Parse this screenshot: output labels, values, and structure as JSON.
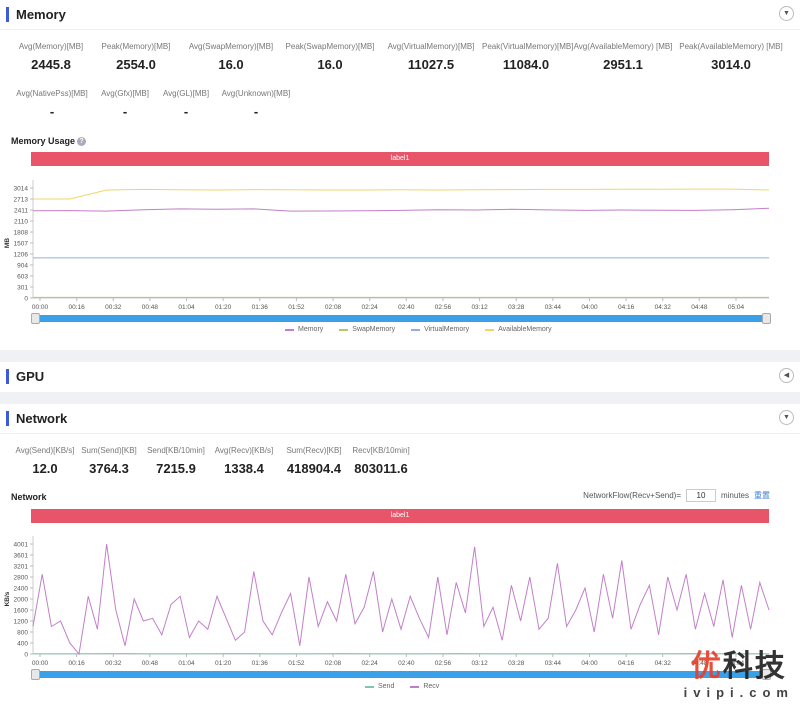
{
  "memory": {
    "title": "Memory",
    "stats_row1": [
      {
        "label": "Avg(Memory)[MB]",
        "value": "2445.8"
      },
      {
        "label": "Peak(Memory)[MB]",
        "value": "2554.0"
      },
      {
        "label": "Avg(SwapMemory)[MB]",
        "value": "16.0"
      },
      {
        "label": "Peak(SwapMemory)[MB]",
        "value": "16.0"
      },
      {
        "label": "Avg(VirtualMemory)[MB]",
        "value": "11027.5"
      },
      {
        "label": "Peak(VirtualMemory)[MB]",
        "value": "11084.0"
      },
      {
        "label": "Avg(AvailableMemory) [MB]",
        "value": "2951.1"
      },
      {
        "label": "Peak(AvailableMemory) [MB]",
        "value": "3014.0"
      }
    ],
    "stats_row2": [
      {
        "label": "Avg(NativePss)[MB]",
        "value": "-"
      },
      {
        "label": "Avg(Gfx)[MB]",
        "value": "-"
      },
      {
        "label": "Avg(GL)[MB]",
        "value": "-"
      },
      {
        "label": "Avg(Unknown)[MB]",
        "value": "-"
      }
    ],
    "chart_title": "Memory Usage",
    "label_bar": "label1"
  },
  "gpu": {
    "title": "GPU"
  },
  "network": {
    "title": "Network",
    "stats": [
      {
        "label": "Avg(Send)[KB/s]",
        "value": "12.0"
      },
      {
        "label": "Sum(Send)[KB]",
        "value": "3764.3"
      },
      {
        "label": "Send[KB/10min]",
        "value": "7215.9"
      },
      {
        "label": "Avg(Recv)[KB/s]",
        "value": "1338.4"
      },
      {
        "label": "Sum(Recv)[KB]",
        "value": "418904.4"
      },
      {
        "label": "Recv[KB/10min]",
        "value": "803011.6"
      }
    ],
    "chart_title": "Network",
    "flow_label": "NetworkFlow(Recv+Send)=",
    "flow_value": "10",
    "flow_unit": "minutes",
    "reset_label": "重置",
    "label_bar": "label1"
  },
  "watermark": {
    "top_red": "优",
    "top_dark": "科技",
    "bottom": "ivipi.com"
  },
  "chart_data": [
    {
      "type": "line",
      "title": "Memory Usage",
      "xlabel": "",
      "ylabel": "MB",
      "ylim": [
        0,
        3014
      ],
      "yticks": [
        0,
        301,
        603,
        904,
        1206,
        1507,
        1808,
        2110,
        2411,
        2713,
        3014
      ],
      "x": [
        "00:00",
        "00:16",
        "00:32",
        "00:48",
        "01:04",
        "01:20",
        "01:36",
        "01:52",
        "02:08",
        "02:24",
        "02:40",
        "02:56",
        "03:12",
        "03:28",
        "03:44",
        "04:00",
        "04:16",
        "04:32",
        "04:48",
        "05:04"
      ],
      "legend_position": "bottom",
      "series": [
        {
          "name": "Memory",
          "color": "#c27fc9",
          "values": [
            2390,
            2395,
            2380,
            2420,
            2440,
            2430,
            2440,
            2380,
            2385,
            2390,
            2400,
            2420,
            2410,
            2430,
            2415,
            2400,
            2410,
            2405,
            2400,
            2420,
            2460
          ]
        },
        {
          "name": "SwapMemory",
          "color": "#b9c46a",
          "values": [
            16,
            16,
            16,
            16,
            16,
            16,
            16,
            16,
            16,
            16,
            16,
            16,
            16,
            16,
            16,
            16,
            16,
            16,
            16,
            16,
            16
          ]
        },
        {
          "name": "VirtualMemory",
          "color": "#8fb0e0",
          "values": [
            1100,
            1100,
            1100,
            1100,
            1100,
            1100,
            1100,
            1100,
            1100,
            1100,
            1100,
            1100,
            1100,
            1100,
            1100,
            1100,
            1100,
            1100,
            1100,
            1100,
            1100
          ]
        },
        {
          "name": "AvailableMemory",
          "color": "#f0d66a",
          "values": [
            2713,
            2713,
            2960,
            2975,
            2965,
            2960,
            2970,
            2965,
            2960,
            2960,
            2965,
            2960,
            2965,
            2970,
            2975,
            2975,
            2980,
            2980,
            2985,
            2985,
            2960
          ]
        }
      ]
    },
    {
      "type": "line",
      "title": "Network",
      "xlabel": "",
      "ylabel": "KB/s",
      "ylim": [
        0,
        4001
      ],
      "yticks": [
        0,
        400,
        800,
        1200,
        1600,
        2000,
        2400,
        2800,
        3201,
        3601,
        4001
      ],
      "x": [
        "00:00",
        "00:16",
        "00:32",
        "00:48",
        "01:04",
        "01:20",
        "01:36",
        "01:52",
        "02:08",
        "02:24",
        "02:40",
        "02:56",
        "03:12",
        "03:28",
        "03:44",
        "04:00",
        "04:16",
        "04:32",
        "04:48",
        "05:04"
      ],
      "legend_position": "bottom",
      "series": [
        {
          "name": "Send",
          "color": "#7cc6b8",
          "values": [
            10,
            12,
            15,
            10,
            12,
            14,
            10,
            12,
            13,
            10,
            12,
            15,
            10,
            12,
            11,
            10,
            12,
            14,
            10,
            12
          ]
        },
        {
          "name": "Recv",
          "color": "#c27fc9",
          "values": [
            1000,
            2900,
            1000,
            1200,
            400,
            0,
            2100,
            900,
            4001,
            1600,
            300,
            2000,
            1200,
            1300,
            700,
            1800,
            2100,
            600,
            1200,
            900,
            2100,
            1300,
            500,
            800,
            3000,
            1200,
            700,
            1500,
            2200,
            300,
            2800,
            1000,
            1900,
            1200,
            2900,
            1100,
            1700,
            3000,
            800,
            2000,
            900,
            2100,
            1300,
            600,
            2800,
            700,
            2600,
            1500,
            3900,
            1000,
            1700,
            500,
            2500,
            1200,
            2800,
            900,
            1300,
            3300,
            1000,
            1600,
            2400,
            800,
            2900,
            1300,
            3400,
            900,
            1800,
            2500,
            700,
            2800,
            1600,
            2900,
            900,
            2200,
            1000,
            2700,
            600,
            2500,
            900,
            2600,
            1600
          ]
        }
      ]
    }
  ]
}
